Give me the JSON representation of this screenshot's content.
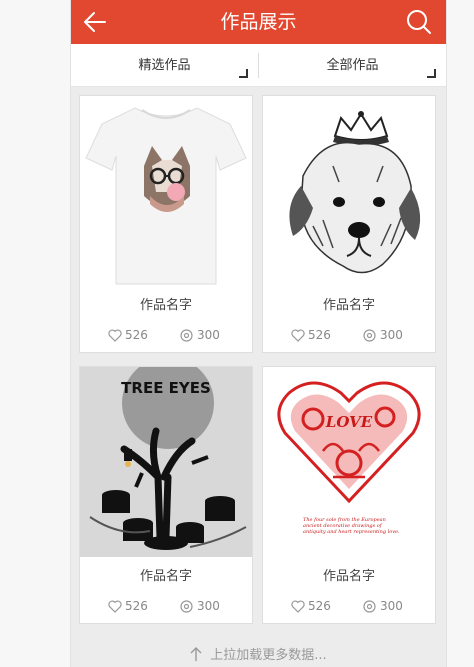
{
  "header": {
    "title": "作品展示",
    "back_icon": "arrow-left-icon",
    "search_icon": "search-icon",
    "color": "#e2472f"
  },
  "filters": [
    {
      "label": "精选作品"
    },
    {
      "label": "全部作品"
    }
  ],
  "works": [
    {
      "name": "作品名字",
      "likes": "526",
      "views": "300",
      "image": "white-tshirt-cat-with-glasses"
    },
    {
      "name": "作品名字",
      "likes": "526",
      "views": "300",
      "image": "yorkie-dog-with-crown-sketch"
    },
    {
      "name": "作品名字",
      "likes": "526",
      "views": "300",
      "image": "tree-eyes-dark-tree-stumps"
    },
    {
      "name": "作品名字",
      "likes": "526",
      "views": "300",
      "image": "red-papercut-love-heart"
    }
  ],
  "heart_art_caption": "The four sole from the European ancient decorative drawings of antiquity and heart representing love.",
  "tree_art_text": "TREE EYES",
  "heart_art_text": "LOVE",
  "load_more": "上拉加载更多数据..."
}
